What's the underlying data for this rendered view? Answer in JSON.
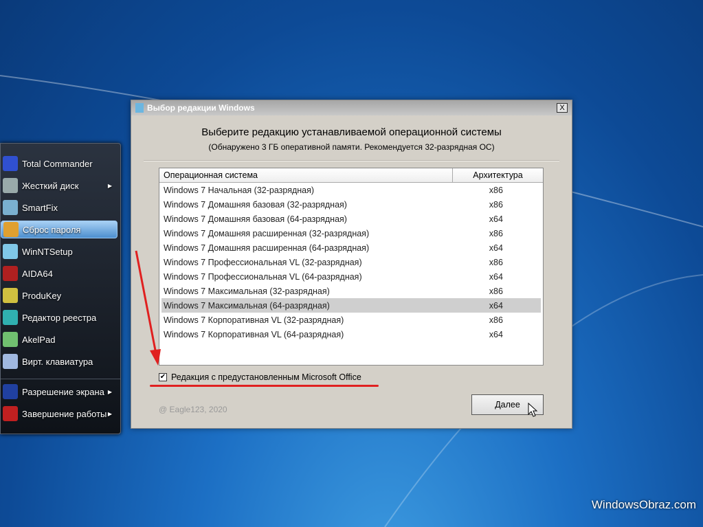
{
  "menu": {
    "items": [
      {
        "label": "Total Commander",
        "icon": "floppy-icon",
        "color": "#3050d0",
        "sub": false
      },
      {
        "label": "Жесткий диск",
        "icon": "hard-disk-icon",
        "color": "#9aa",
        "sub": true
      },
      {
        "label": "SmartFix",
        "icon": "folder-tools-icon",
        "color": "#7ab0d0",
        "sub": false
      },
      {
        "label": "Сброс пароля",
        "icon": "keys-icon",
        "color": "#e0a030",
        "sub": false,
        "selected": true
      },
      {
        "label": "WinNTSetup",
        "icon": "setup-icon",
        "color": "#80c8e8",
        "sub": false
      },
      {
        "label": "AIDA64",
        "icon": "aida64-icon",
        "color": "#b02020",
        "sub": false
      },
      {
        "label": "ProduKey",
        "icon": "key-icon",
        "color": "#d0c040",
        "sub": false
      },
      {
        "label": "Редактор реестра",
        "icon": "registry-icon",
        "color": "#30b0b0",
        "sub": false
      },
      {
        "label": "AkelPad",
        "icon": "notepad-icon",
        "color": "#70c070",
        "sub": false
      },
      {
        "label": "Вирт. клавиатура",
        "icon": "keyboard-icon",
        "color": "#a0b8e0",
        "sub": false
      }
    ],
    "bottom": [
      {
        "label": "Разрешение экрана",
        "icon": "monitor-icon",
        "color": "#2040a0",
        "sub": true
      },
      {
        "label": "Завершение работы",
        "icon": "power-icon",
        "color": "#c02020",
        "sub": true
      }
    ]
  },
  "dialog": {
    "title": "Выбор редакции Windows",
    "close": "X",
    "heading": "Выберите редакцию устанавливаемой операционной системы",
    "subheading": "(Обнаружено 3 ГБ оперативной памяти. Рекомендуется 32-разрядная ОС)",
    "columns": [
      "Операционная система",
      "Архитектура"
    ],
    "rows": [
      [
        "Windows 7 Начальная (32-разрядная)",
        "x86"
      ],
      [
        "Windows 7 Домашняя базовая (32-разрядная)",
        "x86"
      ],
      [
        "Windows 7 Домашняя базовая (64-разрядная)",
        "x64"
      ],
      [
        "Windows 7 Домашняя расширенная (32-разрядная)",
        "x86"
      ],
      [
        "Windows 7 Домашняя расширенная (64-разрядная)",
        "x64"
      ],
      [
        "Windows 7 Профессиональная VL (32-разрядная)",
        "x86"
      ],
      [
        "Windows 7 Профессиональная VL (64-разрядная)",
        "x64"
      ],
      [
        "Windows 7 Максимальная (32-разрядная)",
        "x86"
      ],
      [
        "Windows 7 Максимальная (64-разрядная)",
        "x64"
      ],
      [
        "Windows 7 Корпоративная VL (32-разрядная)",
        "x86"
      ],
      [
        "Windows 7 Корпоративная VL (64-разрядная)",
        "x64"
      ]
    ],
    "selected_row": 8,
    "checkbox_label": "Редакция с предустановленным Microsoft Office",
    "checkbox_checked": true,
    "copyright": "@ Eagle123, 2020",
    "next": "Далее"
  },
  "watermark": "WindowsObraz.com"
}
